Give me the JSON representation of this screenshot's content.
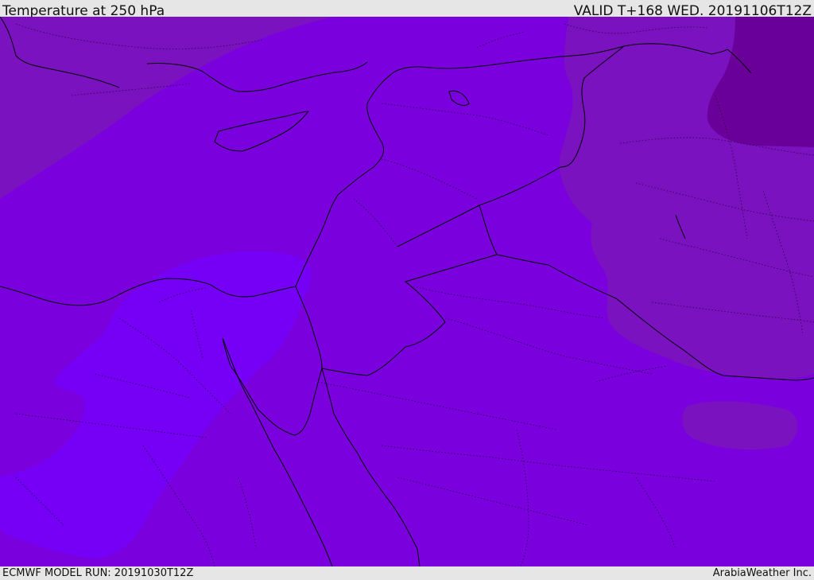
{
  "header": {
    "title": "Temperature at 250 hPa",
    "valid": "VALID T+168 WED. 20191106T12Z"
  },
  "footer": {
    "model_run": "ECMWF MODEL RUN: 20191030T12Z",
    "credit": "ArabiaWeather Inc."
  },
  "colors": {
    "band_mid": "#7a00dd",
    "band_warm": "#7600f6",
    "band_cool": "#7a12c0",
    "band_coldest": "#6a0099",
    "border_line": "#000000"
  }
}
